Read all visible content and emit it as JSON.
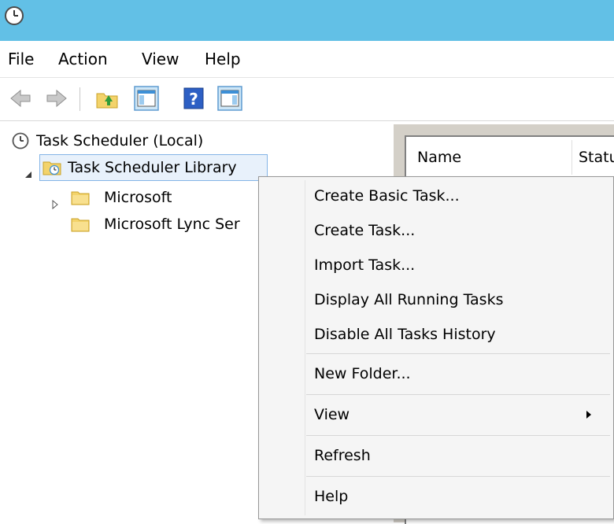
{
  "menubar": {
    "items": [
      "File",
      "Action",
      "View",
      "Help"
    ]
  },
  "toolbar": {
    "buttons": [
      "back-arrow-icon",
      "forward-arrow-icon",
      "up-folder-icon",
      "show-console-tree-icon",
      "help-icon",
      "show-action-pane-icon"
    ]
  },
  "tree": {
    "root": "Task Scheduler (Local)",
    "library": "Task Scheduler Library",
    "children": [
      "Microsoft",
      "Microsoft Lync Ser"
    ]
  },
  "task_list": {
    "columns": [
      "Name",
      "Statu"
    ]
  },
  "context_menu": {
    "items": [
      "Create Basic Task...",
      "Create Task...",
      "Import Task...",
      "Display All Running Tasks",
      "Disable All Tasks History",
      "New Folder...",
      "View",
      "Refresh",
      "Help"
    ]
  },
  "colors": {
    "titlebar": "#62c0e6",
    "menu_background": "#f5f5f5",
    "selection_border": "#84b4e6",
    "selection_fill": "#e8f1fb"
  }
}
